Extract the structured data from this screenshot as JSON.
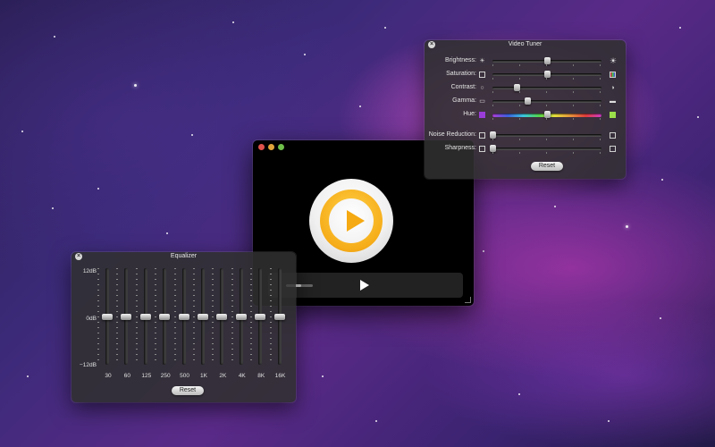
{
  "player": {
    "volume_level": 0.55,
    "play_icon": "play-icon"
  },
  "video_tuner": {
    "title": "Video Tuner",
    "reset_label": "Reset",
    "rows": [
      {
        "label": "Brightness:",
        "value": 0.5,
        "left_icon": "sun-small-icon",
        "right_icon": "sun-large-icon"
      },
      {
        "label": "Saturation:",
        "value": 0.5,
        "left_icon": "saturation-gray-icon",
        "right_icon": "saturation-color-icon"
      },
      {
        "label": "Contrast:",
        "value": 0.22,
        "left_icon": "contrast-low-icon",
        "right_icon": "contrast-high-icon"
      },
      {
        "label": "Gamma:",
        "value": 0.32,
        "left_icon": "gamma-low-icon",
        "right_icon": "gamma-high-icon"
      },
      {
        "label": "Hue:",
        "value": 0.5,
        "left_icon": "hue-purple-icon",
        "right_icon": "hue-green-icon"
      },
      {
        "label": "Noise Reduction:",
        "value": 0.0,
        "left_icon": "noise-low-icon",
        "right_icon": "noise-high-icon"
      },
      {
        "label": "Sharpness:",
        "value": 0.0,
        "left_icon": "sharpness-low-icon",
        "right_icon": "sharpness-high-icon"
      }
    ],
    "colors": {
      "hue_left": "#9a3cd8",
      "hue_right": "#9be04a"
    }
  },
  "equalizer": {
    "title": "Equalizer",
    "reset_label": "Reset",
    "scale": {
      "top": "12dB",
      "mid": "0dB",
      "bottom": "−12dB"
    },
    "bands": [
      {
        "label": "30",
        "gain_db": 0
      },
      {
        "label": "60",
        "gain_db": 0
      },
      {
        "label": "125",
        "gain_db": 0
      },
      {
        "label": "250",
        "gain_db": 0
      },
      {
        "label": "500",
        "gain_db": 0
      },
      {
        "label": "1K",
        "gain_db": 0
      },
      {
        "label": "2K",
        "gain_db": 0
      },
      {
        "label": "4K",
        "gain_db": 0
      },
      {
        "label": "8K",
        "gain_db": 0
      },
      {
        "label": "16K",
        "gain_db": 0
      }
    ]
  }
}
